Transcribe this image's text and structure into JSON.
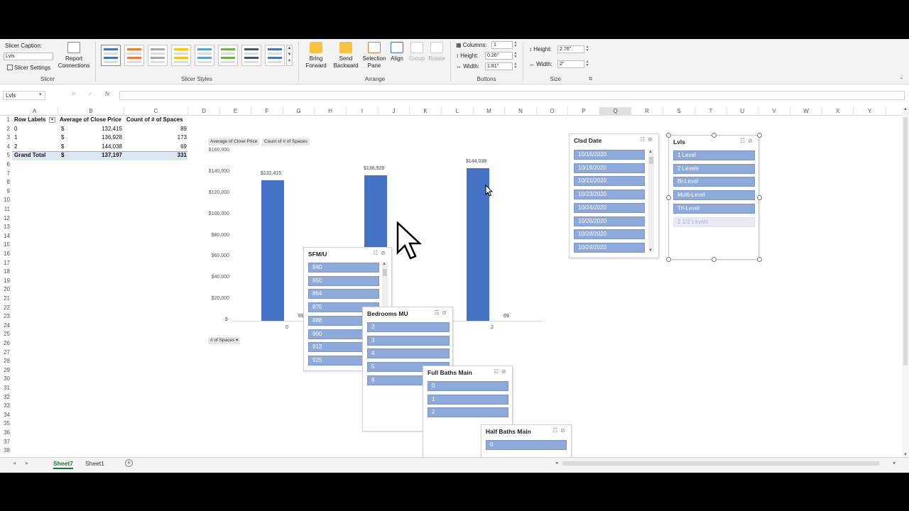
{
  "ribbon": {
    "slicer_caption_label": "Slicer Caption:",
    "slicer_caption_value": "Lvls",
    "slicer_settings": "Slicer Settings",
    "report_connections_1": "Report",
    "report_connections_2": "Connections",
    "group_slicer": "Slicer",
    "group_slicer_styles": "Slicer Styles",
    "bring_forward_1": "Bring",
    "bring_forward_2": "Forward",
    "send_backward_1": "Send",
    "send_backward_2": "Backward",
    "selection_pane_1": "Selection",
    "selection_pane_2": "Pane",
    "align": "Align",
    "group": "Group",
    "rotate": "Rotate",
    "group_arrange": "Arrange",
    "columns_label": "Columns:",
    "columns_value": "1",
    "btn_height_label": "Height:",
    "btn_height_value": "0.26\"",
    "btn_width_label": "Width:",
    "btn_width_value": "1.81\"",
    "group_buttons": "Buttons",
    "size_height_label": "Height:",
    "size_height_value": "2.76\"",
    "size_width_label": "Width:",
    "size_width_value": "2\"",
    "group_size": "Size"
  },
  "formula": {
    "namebox": "Lvls",
    "fx": "fx"
  },
  "columns": [
    "A",
    "B",
    "C",
    "D",
    "E",
    "F",
    "G",
    "H",
    "I",
    "J",
    "K",
    "L",
    "M",
    "N",
    "O",
    "P",
    "Q",
    "R",
    "S",
    "T",
    "U",
    "V",
    "W",
    "X",
    "Y"
  ],
  "rows": [
    "1",
    "2",
    "3",
    "4",
    "5",
    "6",
    "7",
    "8",
    "9",
    "10",
    "11",
    "12",
    "13",
    "14",
    "15",
    "16",
    "17",
    "18",
    "19",
    "20",
    "21",
    "22",
    "23",
    "24",
    "25",
    "26",
    "27",
    "28",
    "29",
    "30",
    "31",
    "32",
    "33",
    "34",
    "35",
    "36",
    "37",
    "38"
  ],
  "pivot": {
    "header_a": "Row Labels",
    "header_b": "Average of Close Price",
    "header_c": "Count of # of Spaces",
    "rows": [
      {
        "label": "0",
        "currency": "$",
        "avg": "132,415",
        "count": "89"
      },
      {
        "label": "1",
        "currency": "$",
        "avg": "136,928",
        "count": "173"
      },
      {
        "label": "2",
        "currency": "$",
        "avg": "144,038",
        "count": "69"
      }
    ],
    "total": {
      "label": "Grand Total",
      "currency": "$",
      "avg": "137,197",
      "count": "331"
    }
  },
  "chart_data": {
    "type": "bar",
    "categories": [
      "0",
      "1",
      "2"
    ],
    "series": [
      {
        "name": "Average of Close Price",
        "values": [
          132415,
          136928,
          144038
        ]
      },
      {
        "name": "Count of # of Spaces",
        "values": [
          89,
          173,
          69
        ]
      }
    ],
    "ylim": [
      0,
      160000
    ],
    "yticks": [
      "$-",
      "$20,000",
      "$40,000",
      "$60,000",
      "$80,000",
      "$100,000",
      "$120,000",
      "$140,000",
      "$160,000"
    ],
    "data_labels": [
      "$132,415",
      "$136,928",
      "$144,038"
    ],
    "count_labels": [
      "89",
      "69"
    ],
    "xtick_labels": [
      "0",
      "2"
    ],
    "field_buttons": [
      "Average of Close Price",
      "Count of # of Spaces"
    ],
    "axis_field": "# of Spaces",
    "bar_color": "#4472c4"
  },
  "slicers": {
    "clsd": {
      "title": "Clsd Date",
      "items": [
        "10/16/2020",
        "10/19/2020",
        "10/21/2020",
        "10/23/2020",
        "10/24/2020",
        "10/26/2020",
        "10/28/2020",
        "10/29/2020"
      ]
    },
    "lvls": {
      "title": "Lvls",
      "items": [
        "1 Level",
        "2 Levels",
        "Bi-Level",
        "Multi-Level",
        "Tri-Level",
        "2 1/2 Levels"
      ]
    },
    "sfm": {
      "title": "SFM/U",
      "items": [
        "840",
        "850",
        "864",
        "875",
        "888",
        "900",
        "912",
        "925"
      ]
    },
    "bedrooms": {
      "title": "Bedrooms MU",
      "items": [
        "2",
        "3",
        "4",
        "5",
        "6"
      ]
    },
    "fullbaths": {
      "title": "Full Baths Main",
      "items": [
        "0",
        "1",
        "2"
      ]
    },
    "halfbaths": {
      "title": "Half Baths Main",
      "items": [
        "0"
      ]
    }
  },
  "sheets": {
    "active": "Sheet7",
    "other": "Sheet1"
  },
  "colors": {
    "slicer_item": "#8eaadb",
    "sheet_tab_active": "#217346"
  }
}
